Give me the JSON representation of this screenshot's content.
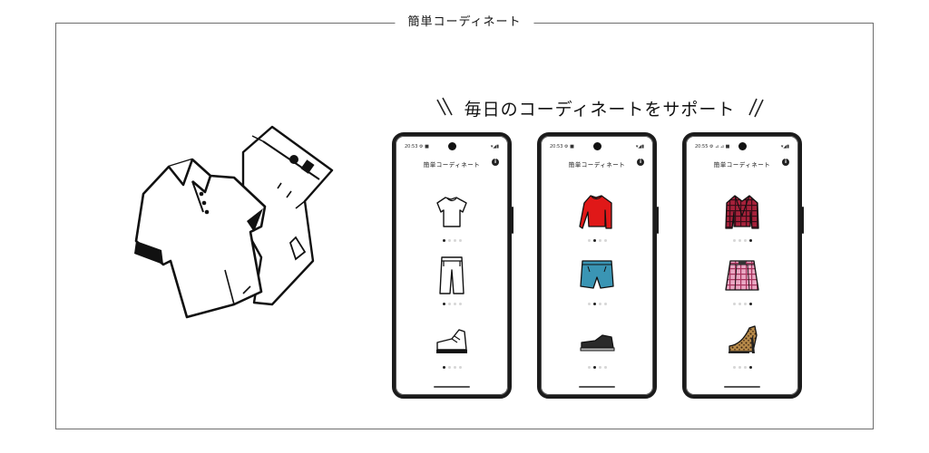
{
  "frame_title": "簡単コーディネート",
  "tagline": "毎日のコーディネートをサポート",
  "colors": {
    "frame_border": "#6e6e6e",
    "phone_body": "#1b1b1b",
    "dot_active": "#222222",
    "dot_inactive": "#d6d6d6"
  },
  "phones": [
    {
      "status_time": "20:53 ⚙ ■",
      "status_icons": "▾◢▮",
      "app_title": "簡単コーディネート",
      "items": [
        {
          "icon": "tshirt-outline-icon",
          "page": 1,
          "pages": 4
        },
        {
          "icon": "jeans-outline-icon",
          "page": 1,
          "pages": 4
        },
        {
          "icon": "sneaker-outline-icon",
          "page": 1,
          "pages": 4
        }
      ]
    },
    {
      "status_time": "20:53 ⚙ ■",
      "status_icons": "▾◢▮",
      "app_title": "簡単コーディネート",
      "items": [
        {
          "icon": "red-sweater-icon",
          "page": 2,
          "pages": 4
        },
        {
          "icon": "denim-shorts-icon",
          "page": 2,
          "pages": 4
        },
        {
          "icon": "black-sneaker-icon",
          "page": 2,
          "pages": 4
        }
      ]
    },
    {
      "status_time": "20:55 ⚙ ⊿ ⊿ ■",
      "status_icons": "▾◢▮",
      "app_title": "簡単コーディネート",
      "items": [
        {
          "icon": "plaid-jacket-icon",
          "page": 4,
          "pages": 4
        },
        {
          "icon": "plaid-skirt-icon",
          "page": 4,
          "pages": 4
        },
        {
          "icon": "leopard-heel-icon",
          "page": 4,
          "pages": 4
        }
      ]
    }
  ]
}
